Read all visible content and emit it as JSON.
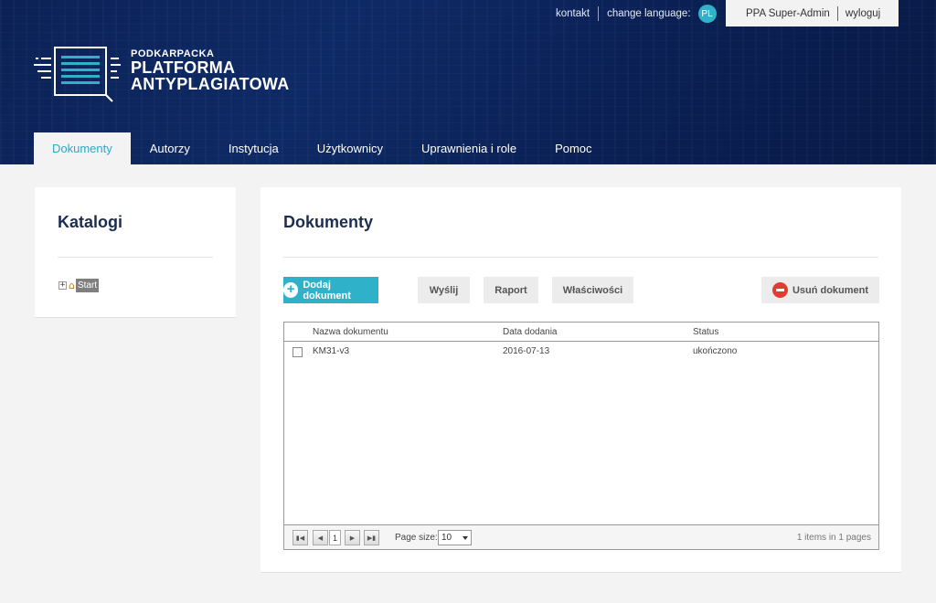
{
  "header": {
    "links": {
      "contact": "kontakt",
      "change_language": "change language:",
      "language_code": "PL"
    },
    "user": {
      "name": "PPA Super-Admin",
      "logout": "wyloguj"
    },
    "logo": {
      "line1": "PODKARPACKA",
      "line2": "PLATFORMA",
      "line3": "ANTYPLAGIATOWA"
    }
  },
  "nav": {
    "items": [
      {
        "label": "Dokumenty",
        "active": true
      },
      {
        "label": "Autorzy"
      },
      {
        "label": "Instytucja"
      },
      {
        "label": "Użytkownicy"
      },
      {
        "label": "Uprawnienia i role"
      },
      {
        "label": "Pomoc"
      }
    ]
  },
  "sidebar": {
    "title": "Katalogi",
    "tree": {
      "root_label": "Start"
    }
  },
  "main": {
    "title": "Dokumenty",
    "buttons": {
      "add": "Dodaj dokument",
      "send": "Wyślij",
      "report": "Raport",
      "properties": "Właściwości",
      "delete": "Usuń dokument"
    },
    "grid": {
      "columns": [
        "Nazwa dokumentu",
        "Data dodania",
        "Status"
      ],
      "rows": [
        {
          "name": "KM31-v3",
          "date": "2016-07-13",
          "status": "ukończono"
        }
      ],
      "pager": {
        "current_page": "1",
        "page_size_label": "Page size:",
        "page_size_value": "10",
        "info": "1 items in 1 pages"
      }
    }
  },
  "colors": {
    "accent": "#2fb2c9",
    "header_bg": "#0c2256",
    "danger": "#e03c31"
  }
}
